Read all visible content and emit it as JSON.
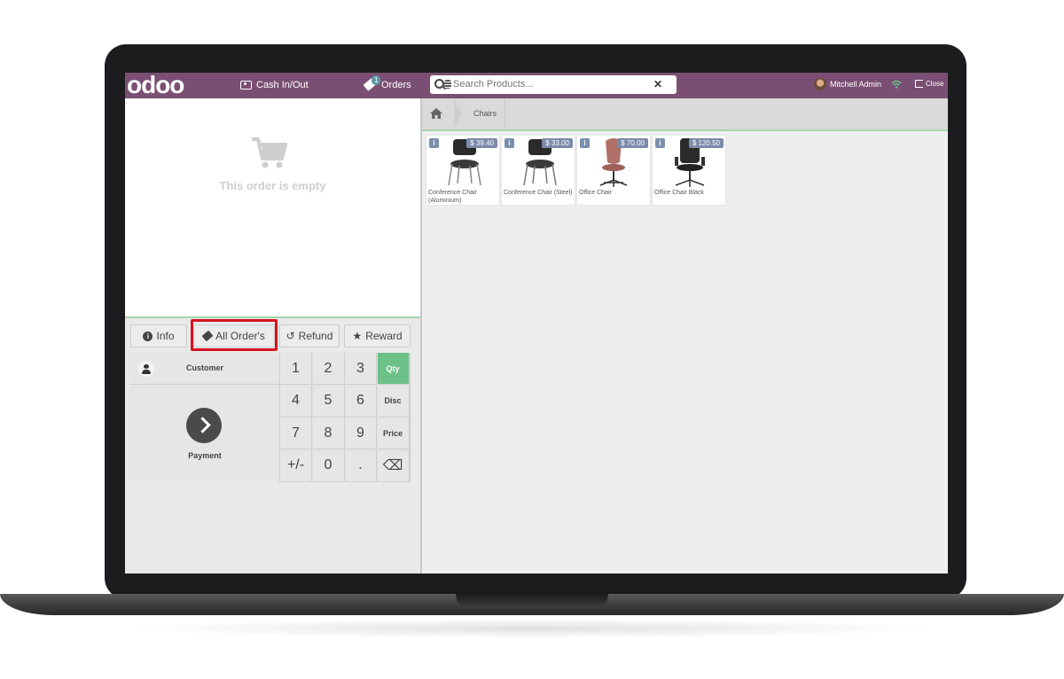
{
  "topbar": {
    "logo": "odoo",
    "cash_label": "Cash In/Out",
    "orders_label": "Orders",
    "orders_badge": "1",
    "search_placeholder": "Search Products...",
    "user_name": "Mitchell Admin",
    "close_label": "Close"
  },
  "order": {
    "empty_message": "This order is empty"
  },
  "controls": {
    "info": "Info",
    "all_orders": "All Order's",
    "refund": "Refund",
    "reward": "Reward"
  },
  "numpad": {
    "customer": "Customer",
    "payment": "Payment",
    "keys": [
      "1",
      "2",
      "3",
      "Qty",
      "4",
      "5",
      "6",
      "Disc",
      "7",
      "8",
      "9",
      "Price",
      "+/-",
      "0",
      ".",
      "⌫"
    ],
    "active_mode": "Qty"
  },
  "breadcrumb": {
    "category": "Chairs"
  },
  "products": [
    {
      "name": "Conference Chair (Aluminium)",
      "price": "$ 39.40",
      "color": "#2b2b2b"
    },
    {
      "name": "Conference Chair (Steel)",
      "price": "$ 33.00",
      "color": "#2b2b2b"
    },
    {
      "name": "Office Chair",
      "price": "$ 70.00",
      "color": "#b07068"
    },
    {
      "name": "Office Chair Black",
      "price": "$ 120.50",
      "color": "#2b2b2b"
    }
  ],
  "colors": {
    "topbar": "#7b4f73",
    "active_key": "#6ec089",
    "highlight": "#d6121f"
  }
}
